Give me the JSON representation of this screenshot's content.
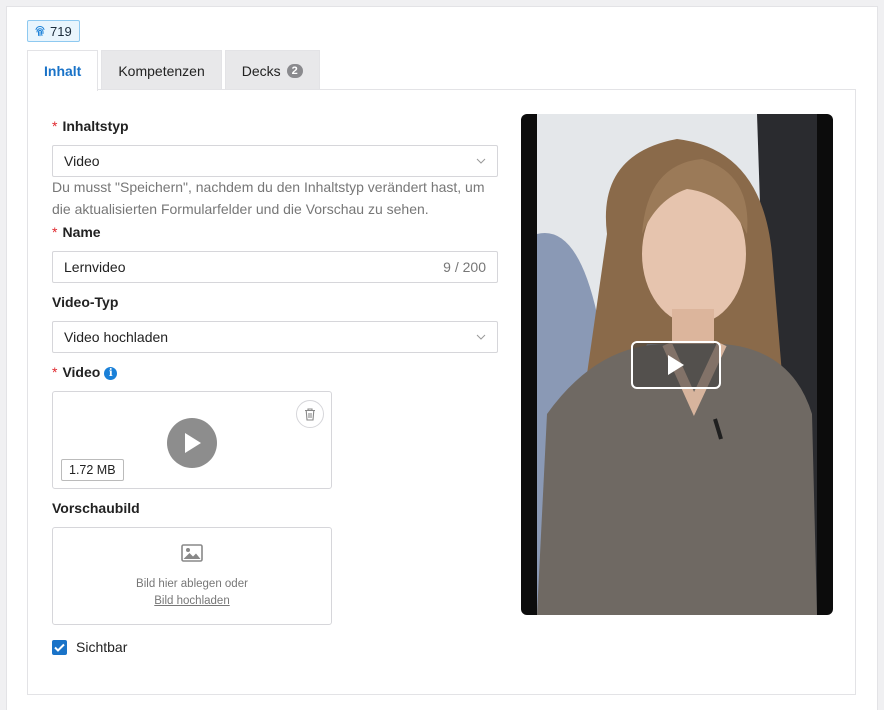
{
  "badge": {
    "icon": "fingerprint-icon",
    "id_text": "719"
  },
  "tabs": [
    {
      "label": "Inhalt",
      "active": true
    },
    {
      "label": "Kompetenzen",
      "active": false
    },
    {
      "label": "Decks",
      "active": false,
      "count": "2"
    }
  ],
  "form": {
    "required_mark": "*",
    "content_type": {
      "label": "Inhaltstyp",
      "value": "Video",
      "hint": "Du musst \"Speichern\", nachdem du den Inhaltstyp verändert hast, um die aktualisierten Formularfelder und die Vorschau zu sehen."
    },
    "name": {
      "label": "Name",
      "value": "Lernvideo",
      "counter": "9 / 200"
    },
    "video_type": {
      "label": "Video-Typ",
      "value": "Video hochladen"
    },
    "video": {
      "label": "Video",
      "info_icon": "i",
      "file_size": "1.72 MB"
    },
    "thumbnail": {
      "label": "Vorschaubild",
      "drop_text": "Bild hier ablegen oder",
      "upload_link": "Bild hochladen"
    },
    "visible": {
      "label": "Sichtbar",
      "checked": true
    }
  },
  "colors": {
    "accent": "#1a73c8",
    "required": "#e0282e",
    "badge_border": "#8ec9f0"
  }
}
